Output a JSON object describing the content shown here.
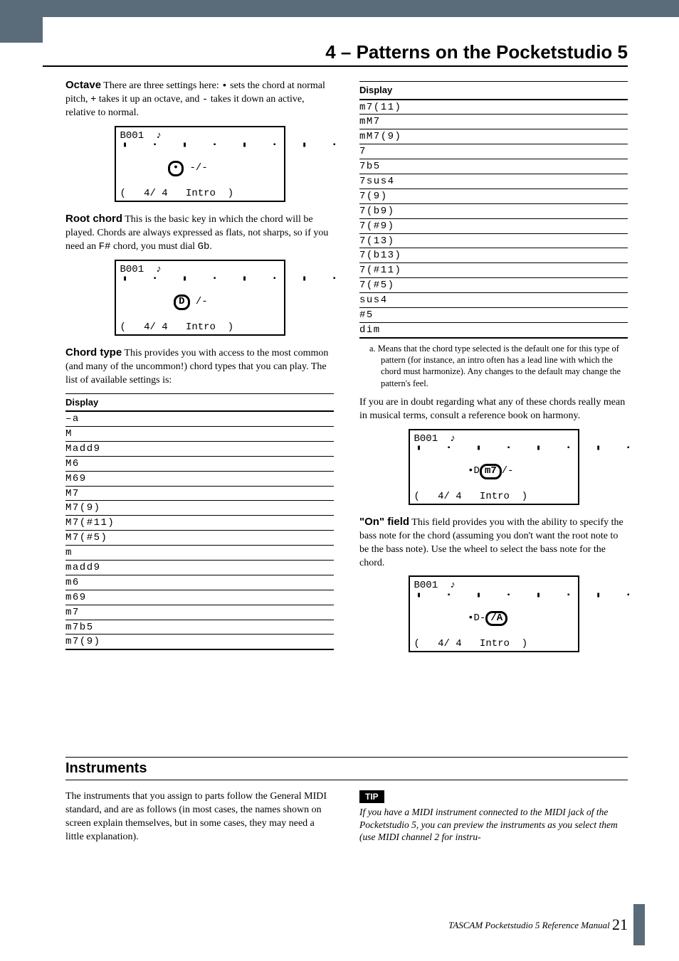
{
  "chapter_title": "4 – Patterns on the Pocketstudio 5",
  "left": {
    "octave": {
      "runin": "Octave",
      "body_a": " There are three settings here: ",
      "dot": "•",
      "body_b": " sets the chord at normal pitch, ",
      "plus": "+",
      "body_c": " takes it up an octave, and ",
      "minus": "-",
      "body_d": " takes it down an active, relative to normal."
    },
    "lcd_octave": {
      "line1": "B001  ♪",
      "dots": "▮  ▪  ▮  ▪  ▮  ▪  ▮  ▪",
      "mark": "•",
      "rest": " -/-",
      "line4": "(   4/ 4   Intro  )"
    },
    "root": {
      "runin": "Root chord",
      "body_a": " This is the basic key in which the chord will be played. Chords are always expressed as flats, not sharps, so if you need an ",
      "code1": "F#",
      "body_b": " chord, you must dial ",
      "code2": "Gb",
      "body_c": "."
    },
    "lcd_root": {
      "line1": "B001  ♪",
      "dots": "▮  ▪  ▮  ▪  ▮  ▪  ▮  ▪",
      "mark": "D",
      "rest": " /-",
      "line4": "(   4/ 4   Intro  )"
    },
    "chordtype": {
      "runin": "Chord type",
      "body": " This provides you with access to the most common (and many of the uncommon!) chord types that you can play. The list of available settings is:"
    },
    "table_head": "Display",
    "table_rows": [
      "–a",
      "M",
      "Madd9",
      "M6",
      "M69",
      "M7",
      "M7(9)",
      "M7(#11)",
      "M7(#5)",
      "m",
      "madd9",
      "m6",
      "m69",
      "m7",
      "m7b5",
      "m7(9)"
    ]
  },
  "right": {
    "table_head": "Display",
    "table_rows": [
      "m7(11)",
      "mM7",
      "mM7(9)",
      "7",
      "7b5",
      "7sus4",
      "7(9)",
      "7(b9)",
      "7(#9)",
      "7(13)",
      "7(b13)",
      "7(#11)",
      "7(#5)",
      "sus4",
      "#5",
      "dim"
    ],
    "footnote": "a.  Means that the chord type selected is the default one for this type of pattern (for instance, an intro often has a lead line with which the chord must harmonize). Any changes to the default may change the pattern's feel.",
    "doubt_para": "If you are in doubt regarding what any of these chords really mean in musical terms, consult a reference book on harmony.",
    "lcd_chord": {
      "line1": "B001  ♪",
      "dots": "▮  ▪  ▮  ▪  ▮  ▪  ▮  ▪",
      "pre": " •D",
      "mark": "m7",
      "rest": "/-",
      "line4": "(   4/ 4   Intro  )"
    },
    "onfield": {
      "runin": "\"On\" field",
      "body": " This field provides you with the ability to specify the bass note for the chord (assuming you don't want the root note to be the bass note). Use the wheel to select the bass note for the chord."
    },
    "lcd_on": {
      "line1": "B001  ♪",
      "dots": "▮  ▪  ▮  ▪  ▮  ▪  ▮  ▪",
      "pre": " •D-",
      "mark": "/A",
      "line4": "(   4/ 4   Intro  )"
    }
  },
  "section": {
    "heading": "Instruments",
    "left_para": "The instruments that you assign to parts follow the General MIDI standard, and are as follows (in most cases, the names shown on screen explain themselves, but in some cases, they may need a little explanation).",
    "tip_label": "TIP",
    "tip_body": "If you have a MIDI instrument connected to the MIDI jack of the Pocketstudio 5, you can preview the instruments as you select them (use MIDI channel 2 for instru-"
  },
  "footer": {
    "text": "TASCAM Pocketstudio 5 Reference Manual ",
    "page": "21"
  }
}
